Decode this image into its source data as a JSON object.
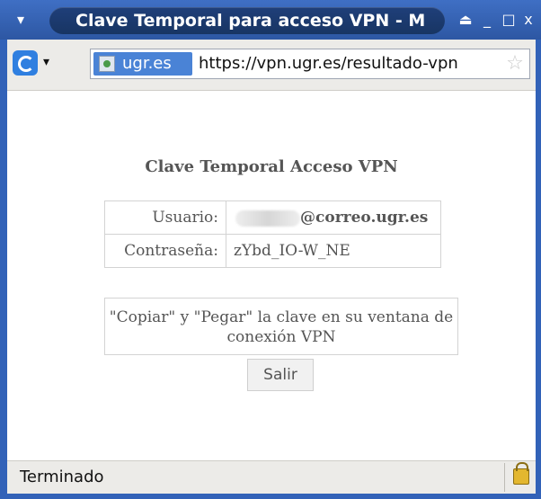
{
  "window": {
    "title": "Clave Temporal para acceso VPN - M",
    "menu_glyph": "▾",
    "controls": {
      "eject": "⏏",
      "minimize": "_",
      "maximize": "□",
      "close": "x"
    }
  },
  "toolbar": {
    "dropdown_glyph": "▾",
    "site_name": "ugr.es",
    "url": "https://vpn.ugr.es/resultado-vpn",
    "star_glyph": "☆"
  },
  "page": {
    "heading": "Clave Temporal Acceso VPN",
    "rows": [
      {
        "label": "Usuario:",
        "value": "@correo.ugr.es"
      },
      {
        "label": "Contraseña:",
        "value": "zYbd_IO-W_NE"
      }
    ],
    "note": "\"Copiar\" y \"Pegar\" la clave en su ventana de conexión VPN",
    "exit_label": "Salir"
  },
  "statusbar": {
    "text": "Terminado"
  },
  "colors": {
    "title_bar": "#3262b8",
    "site_badge": "#4a83d6",
    "text_gray": "#555555",
    "border_gray": "#d3d3d3"
  },
  "icons": [
    "window-menu-icon",
    "duckduckgo-icon",
    "site-identity-icon",
    "bookmark-star-icon",
    "lock-icon"
  ]
}
